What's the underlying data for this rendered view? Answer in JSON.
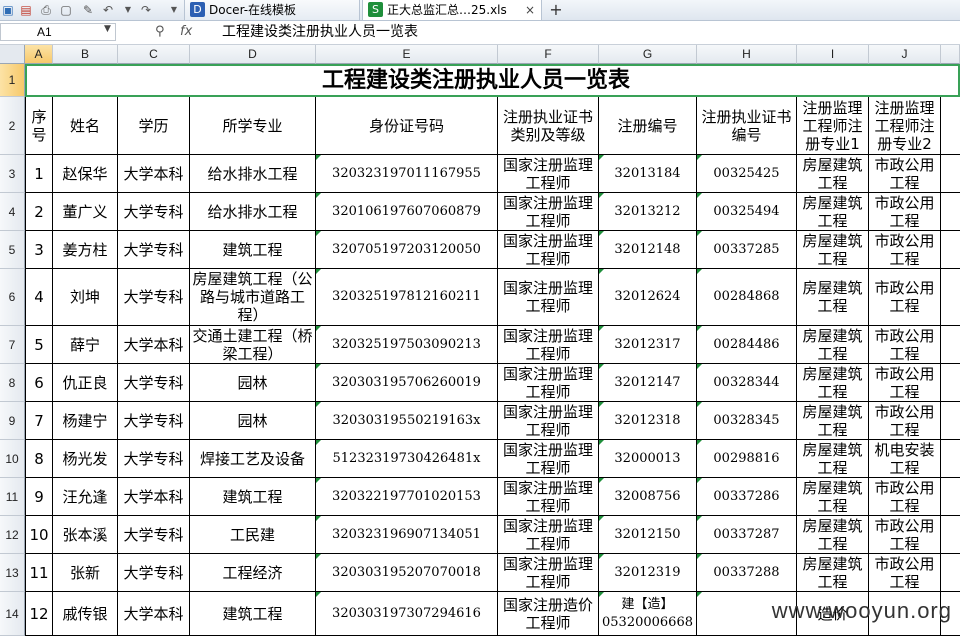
{
  "toolbar": {
    "tabs": [
      {
        "label": "Docer-在线模板",
        "active": false
      },
      {
        "label": "正大总监汇总…25.xls",
        "active": true
      }
    ],
    "new_tab_label": "+",
    "close_label": "×"
  },
  "formula_bar": {
    "cell_ref": "A1",
    "fx_label": "fx",
    "content": "工程建设类注册执业人员一览表"
  },
  "columns": [
    "A",
    "B",
    "C",
    "D",
    "E",
    "F",
    "G",
    "H",
    "I",
    "J"
  ],
  "rows": [
    "1",
    "2",
    "3",
    "4",
    "5",
    "6",
    "7",
    "8",
    "9",
    "10",
    "11",
    "12",
    "13",
    "14"
  ],
  "title": "工程建设类注册执业人员一览表",
  "table": {
    "headers": [
      "序号",
      "姓名",
      "学历",
      "所学专业",
      "身份证号码",
      "注册执业证书类别及等级",
      "注册编号",
      "注册执业证书编号",
      "注册监理工程师注册专业1",
      "注册监理工程师注册专业2"
    ],
    "rows": [
      [
        "1",
        "赵保华",
        "大学本科",
        "给水排水工程",
        "320323197011167955",
        "国家注册监理工程师",
        "32013184",
        "00325425",
        "房屋建筑工程",
        "市政公用工程"
      ],
      [
        "2",
        "董广义",
        "大学专科",
        "给水排水工程",
        "320106197607060879",
        "国家注册监理工程师",
        "32013212",
        "00325494",
        "房屋建筑工程",
        "市政公用工程"
      ],
      [
        "3",
        "姜方柱",
        "大学专科",
        "建筑工程",
        "320705197203120050",
        "国家注册监理工程师",
        "32012148",
        "00337285",
        "房屋建筑工程",
        "市政公用工程"
      ],
      [
        "4",
        "刘坤",
        "大学专科",
        "房屋建筑工程（公路与城市道路工程）",
        "320325197812160211",
        "国家注册监理工程师",
        "32012624",
        "00284868",
        "房屋建筑工程",
        "市政公用工程"
      ],
      [
        "5",
        "薛宁",
        "大学本科",
        "交通土建工程（桥梁工程）",
        "320325197503090213",
        "国家注册监理工程师",
        "32012317",
        "00284486",
        "房屋建筑工程",
        "市政公用工程"
      ],
      [
        "6",
        "仇正良",
        "大学专科",
        "园林",
        "320303195706260019",
        "国家注册监理工程师",
        "32012147",
        "00328344",
        "房屋建筑工程",
        "市政公用工程"
      ],
      [
        "7",
        "杨建宁",
        "大学专科",
        "园林",
        "32030319550219163x",
        "国家注册监理工程师",
        "32012318",
        "00328345",
        "房屋建筑工程",
        "市政公用工程"
      ],
      [
        "8",
        "杨光发",
        "大学专科",
        "焊接工艺及设备",
        "51232319730426481x",
        "国家注册监理工程师",
        "32000013",
        "00298816",
        "房屋建筑工程",
        "机电安装工程"
      ],
      [
        "9",
        "汪允逢",
        "大学本科",
        "建筑工程",
        "320322197701020153",
        "国家注册监理工程师",
        "32008756",
        "00337286",
        "房屋建筑工程",
        "市政公用工程"
      ],
      [
        "10",
        "张本溪",
        "大学专科",
        "工民建",
        "320323196907134051",
        "国家注册监理工程师",
        "32012150",
        "00337287",
        "房屋建筑工程",
        "市政公用工程"
      ],
      [
        "11",
        "张新",
        "大学专科",
        "工程经济",
        "320303195207070018",
        "国家注册监理工程师",
        "32012319",
        "00337288",
        "房屋建筑工程",
        "市政公用工程"
      ],
      [
        "12",
        "戚传银",
        "大学本科",
        "建筑工程",
        "320303197307294616",
        "国家注册造价工程师",
        "建【造】05320006668",
        "",
        "造价",
        ""
      ]
    ]
  },
  "watermark": "www.wooyun.org"
}
